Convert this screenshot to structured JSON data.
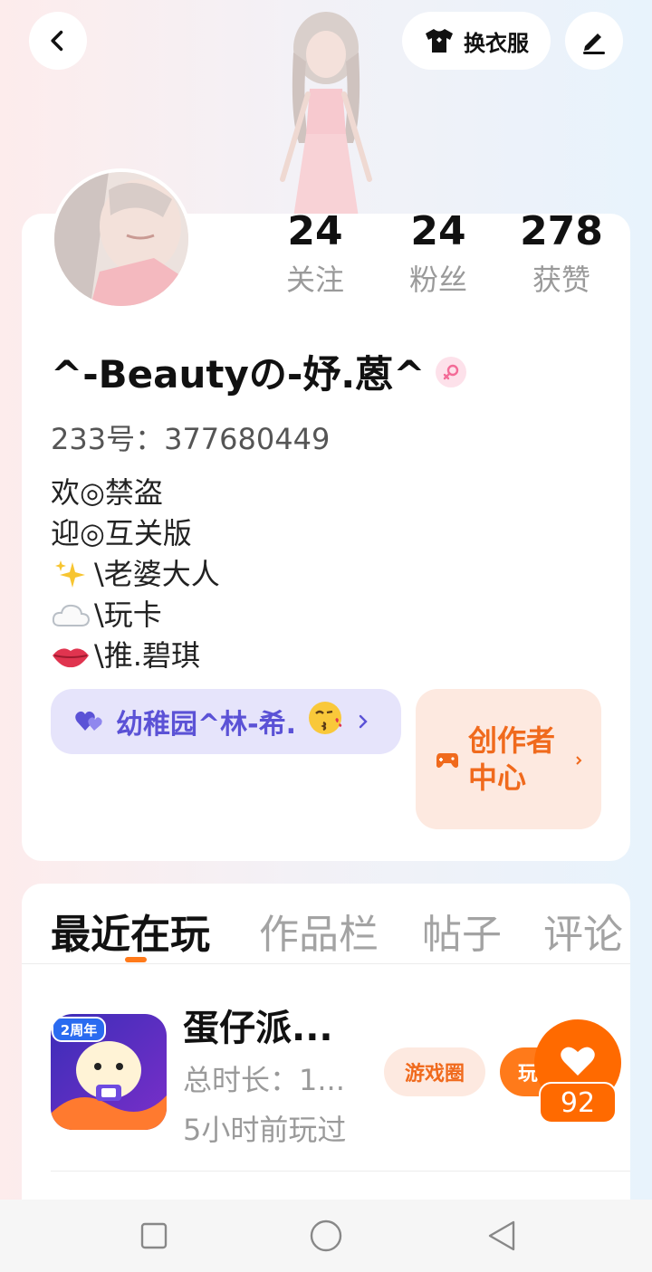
{
  "header": {
    "outfit_label": "换衣服",
    "back_icon": "chevron-left-icon",
    "edit_icon": "pen-icon",
    "outfit_icon": "tshirt-icon"
  },
  "profile": {
    "stats": [
      {
        "value": "24",
        "label": "关注"
      },
      {
        "value": "24",
        "label": "粉丝"
      },
      {
        "value": "278",
        "label": "获赞"
      }
    ],
    "username": "^-Beautyの-妤.蒽^",
    "gender_icon": "female-icon",
    "uid_label": "233号：377680449",
    "bio": [
      {
        "emoji": "",
        "text": "欢◎禁盗"
      },
      {
        "emoji": "",
        "text": "迎◎互关版"
      },
      {
        "emoji": "sparkles-icon",
        "text": "\\老婆大人"
      },
      {
        "emoji": "cloud-icon",
        "text": "\\玩卡"
      },
      {
        "emoji": "lips-icon",
        "text": "\\推.碧琪"
      }
    ],
    "family_label": "幼稚园^林-希.",
    "creator_label": "创作者中心"
  },
  "tabs": [
    "最近在玩",
    "作品栏",
    "帖子",
    "评论"
  ],
  "recent_game": {
    "title": "蛋仔派...",
    "duration": "总时长：1...",
    "last_played": "5小时前玩过",
    "circle_button": "游戏圈",
    "play_button": "玩",
    "icon_badge": "2周年"
  },
  "like_count": "92",
  "colors": {
    "accent": "#ff7a1a",
    "family_text": "#5b52d6",
    "family_bg": "#e6e4fb",
    "creator_bg": "#fde9e0"
  }
}
